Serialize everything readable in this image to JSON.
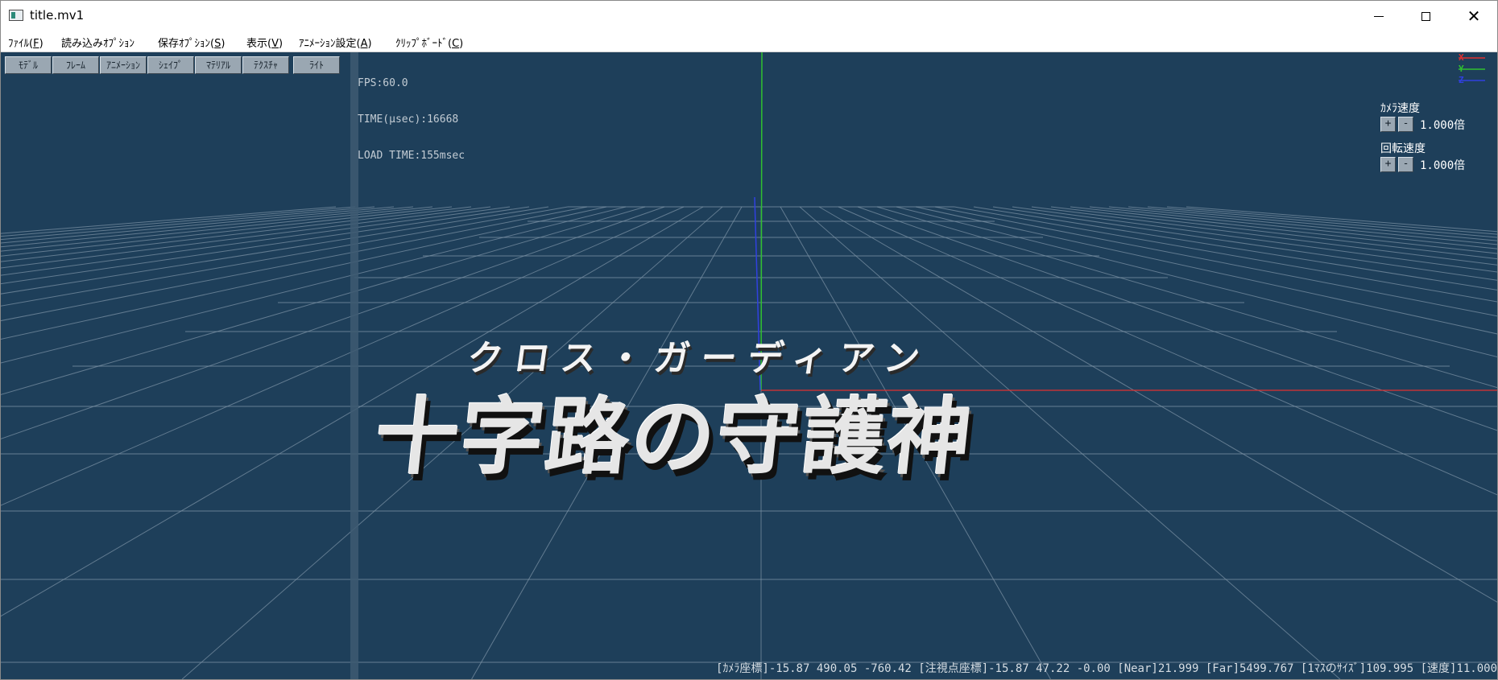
{
  "window": {
    "title": "title.mv1",
    "minimize_icon": "minimize-icon",
    "maximize_icon": "maximize-icon",
    "close_icon": "close-icon",
    "close_glyph": "✕"
  },
  "menubar": {
    "items": [
      {
        "label": "ﾌｧｲﾙ(",
        "key": "F",
        "end": ")"
      },
      {
        "label": "読み込みｵﾌﾟｼｮﾝ",
        "key": "",
        "end": ""
      },
      {
        "label": "保存ｵﾌﾟｼｮﾝ(",
        "key": "S",
        "end": ")"
      },
      {
        "label": "表示(",
        "key": "V",
        "end": ")"
      },
      {
        "label": "ｱﾆﾒｰｼｮﾝ設定(",
        "key": "A",
        "end": ")"
      },
      {
        "label": "ｸﾘｯﾌﾟﾎﾞｰﾄﾞ(",
        "key": "C",
        "end": ")"
      }
    ]
  },
  "toolbar": {
    "buttons": [
      "ﾓﾃﾞﾙ",
      "ﾌﾚｰﾑ",
      "ｱﾆﾒｰｼｮﾝ",
      "ｼｪｲﾌﾟ",
      "ﾏﾃﾘｱﾙ",
      "ﾃｸｽﾁｬ",
      "ﾗｲﾄ"
    ]
  },
  "stats": {
    "fps": "FPS:60.0",
    "time": "TIME(μsec):16668",
    "load": "LOAD TIME:155msec"
  },
  "axis_legend": {
    "x": "X",
    "y": "Y",
    "z": "Z",
    "x_color": "#e03030",
    "y_color": "#30c030",
    "z_color": "#3040e0"
  },
  "camera_speed": {
    "label": "ｶﾒﾗ速度",
    "plus": "+",
    "minus": "-",
    "value": "1.000倍"
  },
  "rotation_speed": {
    "label": "回転速度",
    "plus": "+",
    "minus": "-",
    "value": "1.000倍"
  },
  "model_text": {
    "subtitle": "クロス・ガーディアン",
    "main": "十字路の守護神"
  },
  "statusbar": {
    "text": "[ｶﾒﾗ座標]-15.87 490.05 -760.42 [注視点座標]-15.87 47.22 -0.00 [Near]21.999 [Far]5499.767 [1ﾏｽのｻｲｽﾞ]109.995 [速度]11.000"
  },
  "colors": {
    "viewport_bg": "#1e3f5a",
    "grid": "#7f95a8",
    "x_axis": "#e03030",
    "y_axis": "#30c030",
    "z_axis": "#3040e0"
  }
}
